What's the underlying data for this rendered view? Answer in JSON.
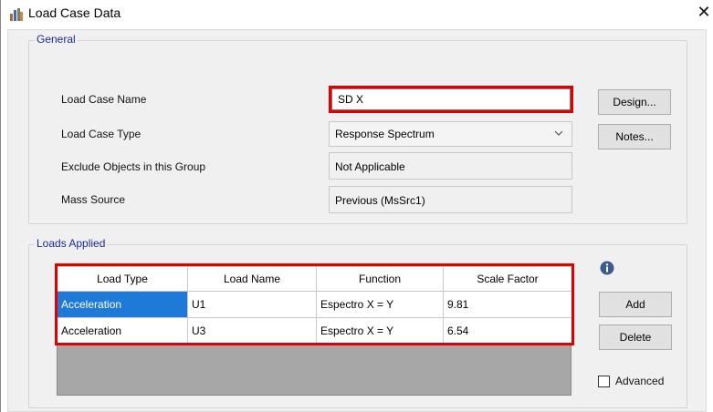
{
  "window": {
    "title": "Load Case Data"
  },
  "general": {
    "legend": "General",
    "load_case_name_label": "Load Case Name",
    "load_case_name_value": "SD X",
    "load_case_type_label": "Load Case Type",
    "load_case_type_value": "Response Spectrum",
    "exclude_label": "Exclude Objects in this Group",
    "exclude_value": "Not Applicable",
    "mass_source_label": "Mass Source",
    "mass_source_value": "Previous  (MsSrc1)",
    "design_button": "Design...",
    "notes_button": "Notes..."
  },
  "loads": {
    "legend": "Loads Applied",
    "columns": [
      "Load Type",
      "Load Name",
      "Function",
      "Scale Factor"
    ],
    "rows": [
      [
        "Acceleration",
        "U1",
        "Espectro X = Y",
        "9.81"
      ],
      [
        "Acceleration",
        "U3",
        "Espectro X = Y",
        "6.54"
      ]
    ],
    "add_button": "Add",
    "delete_button": "Delete",
    "advanced_label": "Advanced"
  },
  "colors": {
    "highlight": "#e00000",
    "selection": "#1f79d6",
    "group_legend": "#1b2a9c"
  }
}
